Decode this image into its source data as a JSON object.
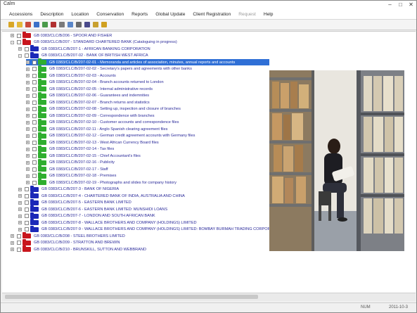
{
  "window": {
    "title": "Calm"
  },
  "menubar": {
    "items": [
      {
        "label": "Accessions"
      },
      {
        "label": "Description"
      },
      {
        "label": "Location"
      },
      {
        "label": "Conservation"
      },
      {
        "label": "Reports"
      },
      {
        "label": "Global Update"
      },
      {
        "label": "Client Registration"
      },
      {
        "label": "Request",
        "dim": true
      },
      {
        "label": "Help"
      }
    ]
  },
  "toolbar": {
    "icons": [
      "new-folder-icon",
      "open-icon",
      "cut-icon",
      "copy-icon",
      "paste-icon",
      "delete-icon",
      "move-icon",
      "tree-icon",
      "list-icon",
      "print-icon",
      "find-icon",
      "help-icon"
    ]
  },
  "tree": {
    "rows": [
      {
        "depth": 0,
        "exp": "+",
        "folder": "red",
        "label": "GB 0383/CLC/B/206 - SPOOR AND FISHER"
      },
      {
        "depth": 0,
        "exp": "-",
        "folder": "red",
        "label": "GB 0383/CLC/B/207 - STANDARD CHARTERED BANK (Cataloguing in progress)"
      },
      {
        "depth": 1,
        "exp": "+",
        "folder": "blue",
        "label": "GB 0383/CLC/B/207-1 - AFRICAN BANKING CORPORATION"
      },
      {
        "depth": 1,
        "exp": "-",
        "folder": "blue",
        "label": "GB 0383/CLC/B/207-02 - BANK OF BRITISH WEST AFRICA"
      },
      {
        "depth": 2,
        "exp": "+",
        "folder": "green",
        "label": "GB 0383/CLC/B/207-02-01 - Memoranda and articles of association, minutes, annual reports and accounts",
        "selected": true
      },
      {
        "depth": 2,
        "exp": "+",
        "folder": "green",
        "label": "GB 0383/CLC/B/207-02-02 - Secretary's papers and agreements with other banks"
      },
      {
        "depth": 2,
        "exp": "+",
        "folder": "green",
        "label": "GB 0383/CLC/B/207-02-03 - Accounts"
      },
      {
        "depth": 2,
        "exp": "+",
        "folder": "green",
        "label": "GB 0383/CLC/B/207-02-04 - Branch accounts returned to London"
      },
      {
        "depth": 2,
        "exp": "+",
        "folder": "green",
        "label": "GB 0383/CLC/B/207-02-05 - Internal administrative records"
      },
      {
        "depth": 2,
        "exp": "+",
        "folder": "green",
        "label": "GB 0383/CLC/B/207-02-06 - Guarantees and indemnities"
      },
      {
        "depth": 2,
        "exp": "+",
        "folder": "green",
        "label": "GB 0383/CLC/B/207-02-07 - Branch returns and statistics"
      },
      {
        "depth": 2,
        "exp": "+",
        "folder": "green",
        "label": "GB 0383/CLC/B/207-02-08 - Setting up, inspection and closure of branches"
      },
      {
        "depth": 2,
        "exp": "+",
        "folder": "green",
        "label": "GB 0383/CLC/B/207-02-09 - Correspondence with branches"
      },
      {
        "depth": 2,
        "exp": "+",
        "folder": "green",
        "label": "GB 0383/CLC/B/207-02-10 - Customer accounts and correspondence files"
      },
      {
        "depth": 2,
        "exp": "+",
        "folder": "green",
        "label": "GB 0383/CLC/B/207-02-11 - Anglo Spanish clearing agreement files"
      },
      {
        "depth": 2,
        "exp": "+",
        "folder": "green",
        "label": "GB 0383/CLC/B/207-02-12 - German credit agreement accounts with Germany files"
      },
      {
        "depth": 2,
        "exp": "+",
        "folder": "green",
        "label": "GB 0383/CLC/B/207-02-13 - West African Currency Board files"
      },
      {
        "depth": 2,
        "exp": "+",
        "folder": "green",
        "label": "GB 0383/CLC/B/207-02-14 - Tax files"
      },
      {
        "depth": 2,
        "exp": "+",
        "folder": "green",
        "label": "GB 0383/CLC/B/207-02-15 - Chief Accountant's files"
      },
      {
        "depth": 2,
        "exp": "+",
        "folder": "green",
        "label": "GB 0383/CLC/B/207-02-16 - Publicity"
      },
      {
        "depth": 2,
        "exp": "+",
        "folder": "green",
        "label": "GB 0383/CLC/B/207-02-17 - Staff"
      },
      {
        "depth": 2,
        "exp": "+",
        "folder": "green",
        "label": "GB 0383/CLC/B/207-02-18 - Premises"
      },
      {
        "depth": 2,
        "exp": "+",
        "folder": "green",
        "label": "GB 0383/CLC/B/207-02-19 - Photographs and slides for company history"
      },
      {
        "depth": 1,
        "exp": "+",
        "folder": "blue",
        "label": "GB 0383/CLC/B/207-3 - BANK OF NIGERIA"
      },
      {
        "depth": 1,
        "exp": "+",
        "folder": "blue",
        "label": "GB 0383/CLC/B/207-4 - CHARTERED BANK OF INDIA, AUSTRALIA AND CHINA"
      },
      {
        "depth": 1,
        "exp": "+",
        "folder": "blue",
        "label": "GB 0383/CLC/B/207-5 - EASTERN BANK LIMITED"
      },
      {
        "depth": 1,
        "exp": "+",
        "folder": "blue",
        "label": "GB 0383/CLC/B/207-6 - EASTERN BANK LIMITED: MUNSHIDI LOANS"
      },
      {
        "depth": 1,
        "exp": "+",
        "folder": "blue",
        "label": "GB 0383/CLC/B/207-7 - LONDON AND SOUTH AFRICAN BANK"
      },
      {
        "depth": 1,
        "exp": "+",
        "folder": "blue",
        "label": "GB 0383/CLC/B/207-8 - WALLACE BROTHERS AND COMPANY (HOLDINGS) LIMITED"
      },
      {
        "depth": 1,
        "exp": "+",
        "folder": "blue",
        "label": "GB 0383/CLC/B/207-9 - WALLACE BROTHERS AND COMPANY (HOLDINGS) LIMITED: BOMBAY BURMAH TRADING CORPORATION"
      },
      {
        "depth": 0,
        "exp": "+",
        "folder": "red",
        "label": "GB 0383/CLC/B/208 - STEEL BROTHERS LIMITED"
      },
      {
        "depth": 0,
        "exp": "+",
        "folder": "red",
        "label": "GB 0383/CLC/B/209 - STRATTON AND BREWIN"
      },
      {
        "depth": 0,
        "exp": "+",
        "folder": "red",
        "label": "GB 0383/CLC/B/210 - BRUNSKILL, SUTTON AND WEBBRAND"
      }
    ]
  },
  "photo": {
    "description_icon": "archive-reading-photo"
  },
  "status": {
    "user": "NUM",
    "date": "2011-10-3"
  },
  "colors": {
    "selection": "#2f6fd6",
    "folder_red": "#c8161d",
    "folder_blue": "#1b28b8",
    "folder_green": "#2fae2f"
  }
}
